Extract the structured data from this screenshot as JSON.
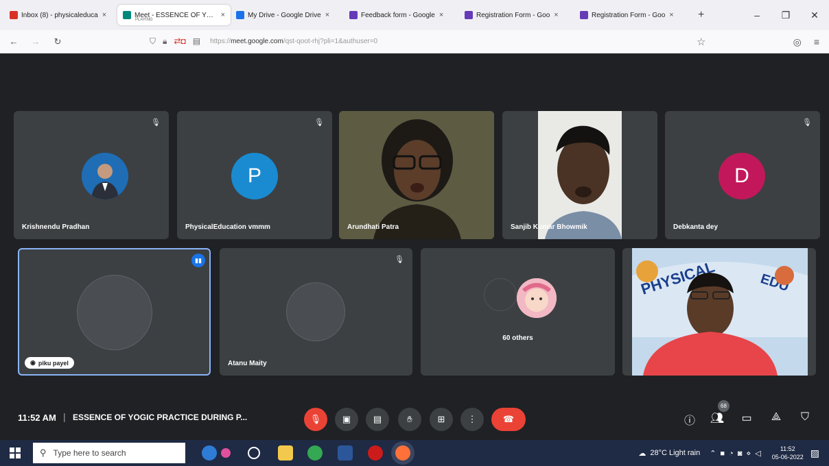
{
  "browser": {
    "tabs": [
      {
        "title": "Inbox (8) - physicaleduca",
        "sub": "",
        "color": "#d93025"
      },
      {
        "title": "Meet - ESSENCE OF YOGI",
        "sub": "PLAYING",
        "color": "#00897b"
      },
      {
        "title": "My Drive - Google Drive",
        "sub": "",
        "color": "#1a73e8"
      },
      {
        "title": "Feedback form - Google",
        "sub": "",
        "color": "#673ab7"
      },
      {
        "title": "Registration Form - Goo",
        "sub": "",
        "color": "#673ab7"
      },
      {
        "title": "Registration Form - Goo",
        "sub": "",
        "color": "#673ab7"
      }
    ],
    "new_tab": "+",
    "close": "×",
    "url_prefix": "https://",
    "url_domain": "meet.google.com",
    "url_path": "/qst-qoot-rhj?pli=1&authuser=0"
  },
  "meet": {
    "top_tiles": [
      {
        "name": "Krishnendu Pradhan",
        "kind": "photo-avatar",
        "muted": true
      },
      {
        "name": "PhysicalEducation vmmm",
        "kind": "letter",
        "letter": "P",
        "color": "#1a8bd1",
        "muted": true
      },
      {
        "name": "Arundhati Patra",
        "kind": "video",
        "muted": false
      },
      {
        "name": "Sanjib Kumar Bhowmik",
        "kind": "video",
        "muted": false
      },
      {
        "name": "Debkanta dey",
        "kind": "letter",
        "letter": "D",
        "color": "#c2185b",
        "muted": true
      }
    ],
    "bottom_tiles": [
      {
        "name": "piku payel",
        "kind": "blank",
        "speaking": true
      },
      {
        "name": "Atanu Maity",
        "kind": "blank",
        "muted": true
      },
      {
        "name": "60 others",
        "kind": "others"
      },
      {
        "name": "",
        "kind": "video"
      }
    ],
    "time": "11:52 AM",
    "separator": "|",
    "meeting_title": "ESSENCE OF YOGIC PRACTICE DURING P...",
    "participant_count": "68"
  },
  "taskbar": {
    "search_placeholder": "Type here to search",
    "weather": "28°C  Light rain",
    "time": "11:52",
    "date": "05-06-2022"
  }
}
